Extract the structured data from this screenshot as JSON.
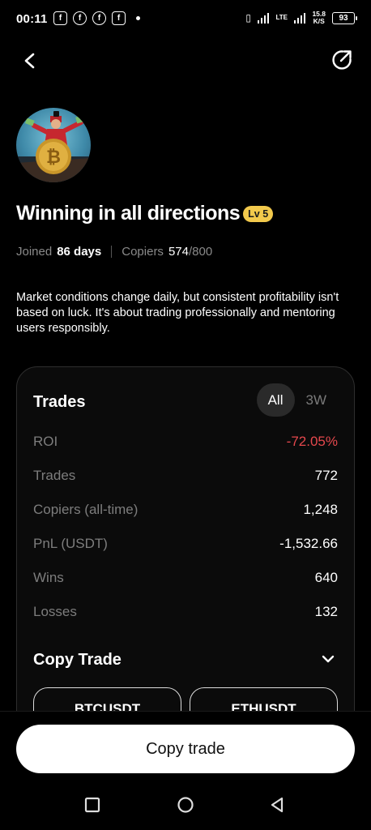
{
  "status_bar": {
    "time": "00:11",
    "network": "LTE",
    "speed_value": "15.8",
    "speed_unit": "K/S",
    "battery": "93"
  },
  "profile": {
    "name": "Winning in all directions",
    "level": "Lv 5",
    "joined_label": "Joined",
    "joined_value": "86 days",
    "copiers_label": "Copiers",
    "copiers_current": "574",
    "copiers_max": "/800",
    "bio": "Market conditions change daily, but consistent profitability isn't based on luck. It's about trading professionally and mentoring users responsibly."
  },
  "stats_card": {
    "title": "Trades",
    "tabs": [
      {
        "label": "All",
        "active": true
      },
      {
        "label": "3W",
        "active": false
      }
    ],
    "rows": [
      {
        "label": "ROI",
        "value": "-72.05%"
      },
      {
        "label": "Trades",
        "value": "772"
      },
      {
        "label": "Copiers (all-time)",
        "value": "1,248"
      },
      {
        "label": "PnL (USDT)",
        "value": "-1,532.66"
      },
      {
        "label": "Wins",
        "value": "640"
      },
      {
        "label": "Losses",
        "value": "132"
      }
    ],
    "copy_trade_title": "Copy Trade",
    "pairs": [
      "BTCUSDT",
      "ETHUSDT"
    ]
  },
  "cta": {
    "label": "Copy trade"
  },
  "colors": {
    "negative": "#e5484d",
    "badge": "#f2c94c",
    "background": "#000000"
  },
  "icons": [
    "back-arrow-icon",
    "share-icon",
    "chevron-down-icon",
    "recents-icon",
    "home-icon",
    "back-nav-icon"
  ]
}
